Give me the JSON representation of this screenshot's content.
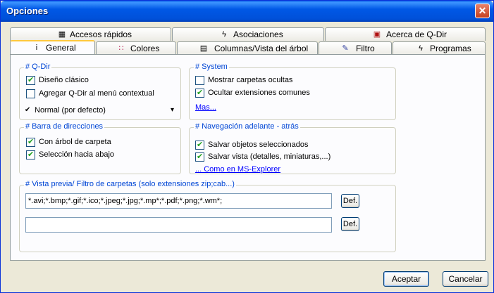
{
  "window": {
    "title": "Opciones",
    "close_glyph": "✕"
  },
  "tabs_top": [
    {
      "label": "Accesos rápidos",
      "icon": "shortcut-icon",
      "glyph": "▦"
    },
    {
      "label": "Asociaciones",
      "icon": "lightning-icon",
      "glyph": "ϟ"
    },
    {
      "label": "Acerca de Q-Dir",
      "icon": "about-icon",
      "glyph": "▣"
    }
  ],
  "tabs_bottom": [
    {
      "label": "General",
      "icon": "info-icon",
      "glyph": "i",
      "active": true
    },
    {
      "label": "Colores",
      "icon": "colors-icon",
      "glyph": "∷"
    },
    {
      "label": "Columnas/Vista del árbol",
      "icon": "columns-icon",
      "glyph": "▤"
    },
    {
      "label": "Filtro",
      "icon": "filter-icon",
      "glyph": "✎"
    },
    {
      "label": "Programas",
      "icon": "programs-icon",
      "glyph": "ϟ"
    }
  ],
  "qdir": {
    "legend": "# Q-Dir",
    "options": [
      {
        "label": "Diseño clásico",
        "checked": true
      },
      {
        "label": "Agregar Q-Dir al menú contextual",
        "checked": false
      }
    ],
    "mode_check": "✔",
    "mode": "Normal (por defecto)",
    "mode_arrow": "▾"
  },
  "system": {
    "legend": "# System",
    "options": [
      {
        "label": "Mostrar carpetas ocultas",
        "checked": false
      },
      {
        "label": "Ocultar extensiones comunes",
        "checked": true
      }
    ],
    "more_link": "Mas..."
  },
  "address_bar": {
    "legend": "# Barra de direcciones",
    "options": [
      {
        "label": "Con árbol de carpeta",
        "checked": true
      },
      {
        "label": "Selección hacia abajo",
        "checked": true
      }
    ]
  },
  "navigation": {
    "legend": "# Navegación adelante - atrás",
    "options": [
      {
        "label": "Salvar objetos seleccionados",
        "checked": true
      },
      {
        "label": "Salvar vista (detalles, miniaturas,...)",
        "checked": true
      }
    ],
    "explorer_link": "... Como en MS-Explorer"
  },
  "preview": {
    "legend": "# Vista previa/ Filtro de carpetas (solo extensiones zip;cab...)",
    "filter1_value": "*.avi;*.bmp;*.gif;*.ico;*.jpeg;*.jpg;*.mp*;*.pdf;*.png;*.wm*;",
    "filter2_value": "",
    "def_label": "Def."
  },
  "footer": {
    "accept": "Aceptar",
    "cancel": "Cancelar"
  }
}
